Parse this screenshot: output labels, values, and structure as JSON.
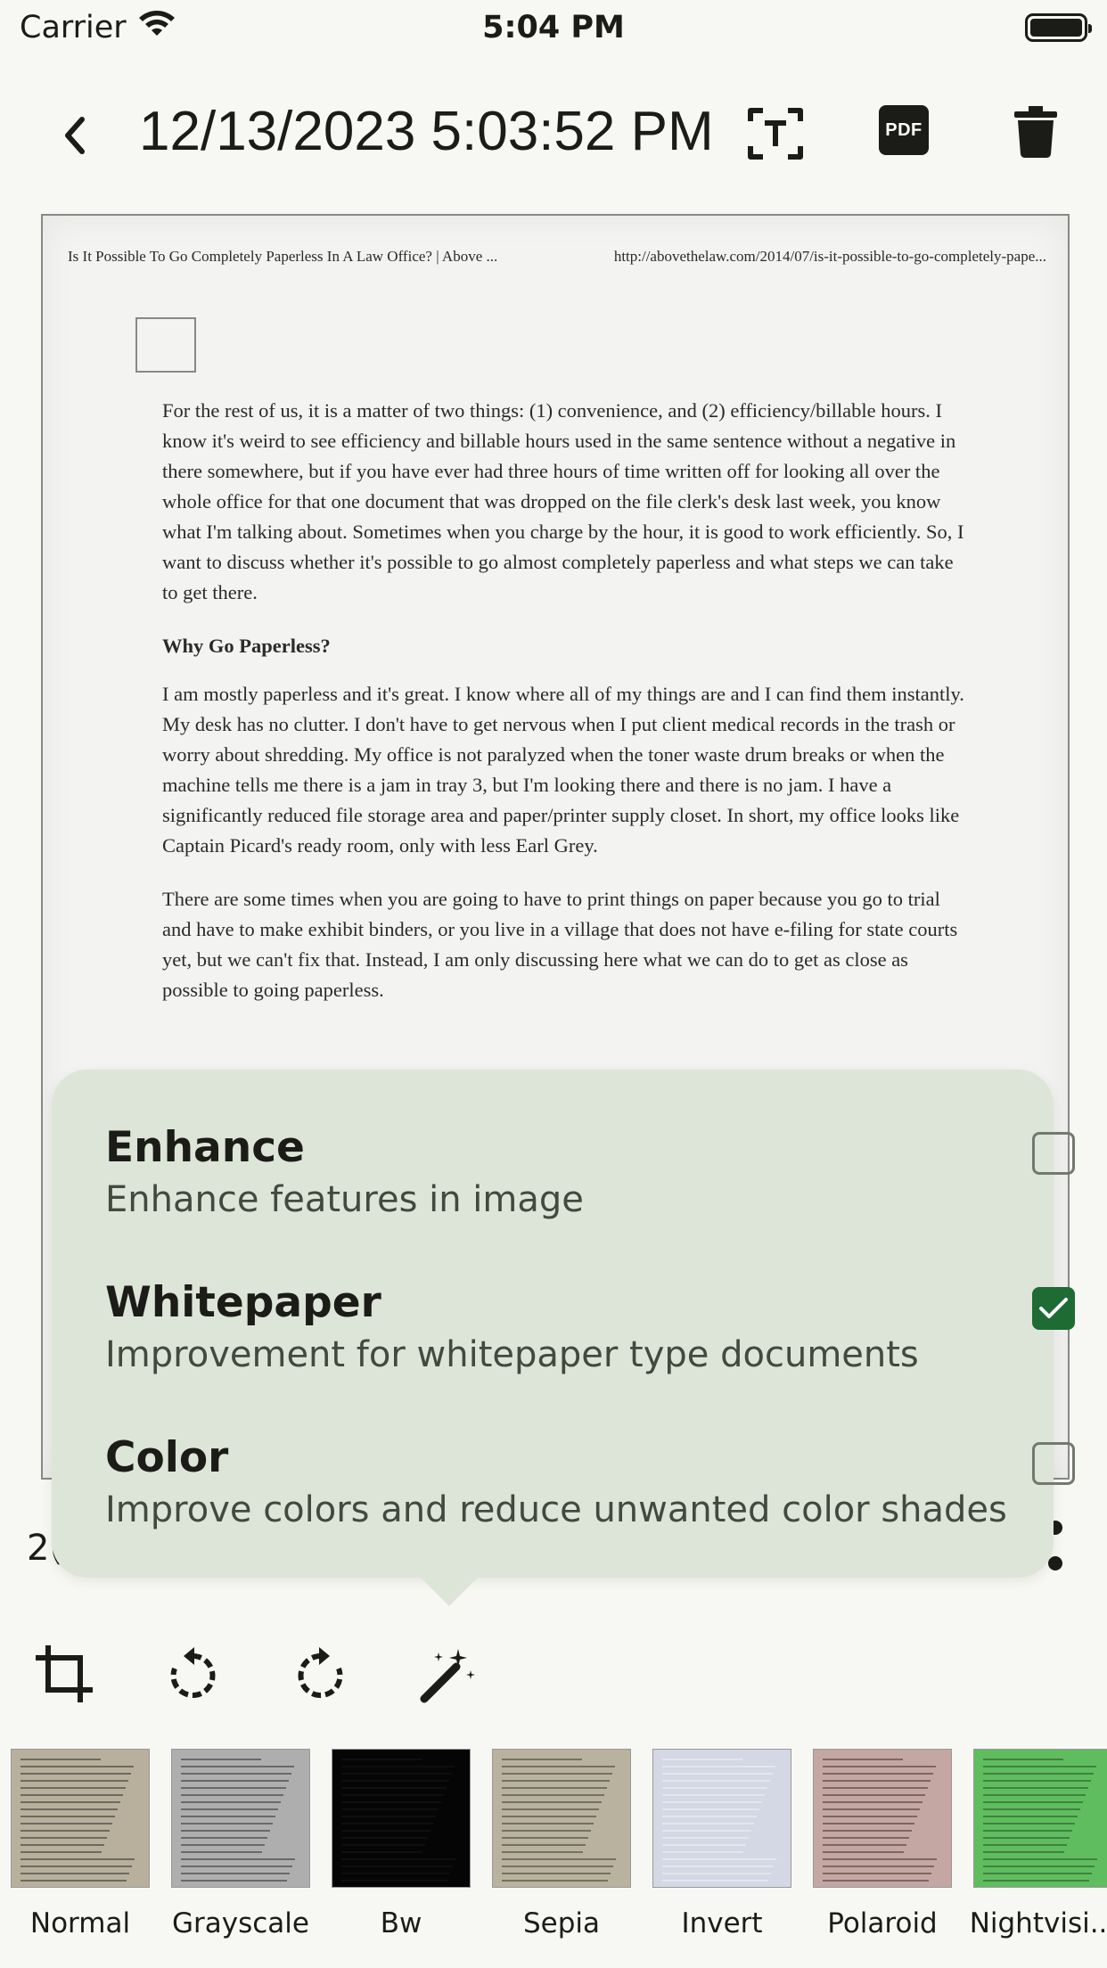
{
  "status_bar": {
    "carrier": "Carrier",
    "time": "5:04 PM"
  },
  "toolbar": {
    "title": "12/13/2023 5:03:52 PM",
    "pdf_label": "PDF"
  },
  "document": {
    "header_left": "Is It Possible To Go Completely Paperless In A Law Office? | Above ...",
    "header_right": "http://abovethelaw.com/2014/07/is-it-possible-to-go-completely-pape...",
    "paragraph_1": "For the rest of us, it is a matter of two things: (1) convenience, and (2) efficiency/billable hours. I know it's weird to see efficiency and billable hours used in the same sentence without a negative in there somewhere, but if you have ever had three hours of time written off for looking all over the whole office for that one document that was dropped on the file clerk's desk last week, you know what I'm talking about. Sometimes when you charge by the hour, it is good to work efficiently. So, I want to discuss whether it's possible to go almost completely paperless and what steps we can take to get there.",
    "heading": "Why Go Paperless?",
    "paragraph_2": "I am mostly paperless and it's great. I know where all of my things are and I can find them instantly. My desk has no clutter. I don't have to get nervous when I put client medical records in the trash or worry about shredding. My office is not paralyzed when the toner waste drum breaks or when the machine tells me there is a jam in tray 3, but I'm looking there and there is no jam. I have a significantly reduced file storage area and paper/printer supply closet. In short, my office looks like Captain Picard's ready room, only with less Earl Grey.",
    "paragraph_3": "There are some times when you are going to have to print things on paper because you go to trial and have to make exhibit binders, or you live in a village that does not have e-filing for state courts yet, but we can't fix that. Instead, I am only discussing here what we can do to get as close as possible to going paperless."
  },
  "page_indicator": "2(",
  "enhance_popup": {
    "options": [
      {
        "title": "Enhance",
        "description": "Enhance features in image",
        "checked": false
      },
      {
        "title": "Whitepaper",
        "description": "Improvement for whitepaper type documents",
        "checked": true
      },
      {
        "title": "Color",
        "description": "Improve colors and reduce unwanted color shades",
        "checked": false
      }
    ]
  },
  "edit_tools": [
    "crop-icon",
    "rotate-left-icon",
    "rotate-right-icon",
    "magic-wand-icon"
  ],
  "filters": [
    {
      "label": "Normal",
      "bg": "#b8b09c",
      "ink": "#3a3a3a"
    },
    {
      "label": "Grayscale",
      "bg": "#aeaeae",
      "ink": "#3a3a3a"
    },
    {
      "label": "Bw",
      "bg": "#050505",
      "ink": "#151515"
    },
    {
      "label": "Sepia",
      "bg": "#b9b29e",
      "ink": "#4a4436"
    },
    {
      "label": "Invert",
      "bg": "#d4d8e4",
      "ink": "#eef0f5"
    },
    {
      "label": "Polaroid",
      "bg": "#c4a7a2",
      "ink": "#4e3a37"
    },
    {
      "label": "Nightvisi...",
      "bg": "#5fbd5f",
      "ink": "#2b5a2b"
    }
  ],
  "colors": {
    "popup_bg": "#dde5d8",
    "check_accent": "#1f6b34",
    "background": "#f7f8f3"
  }
}
